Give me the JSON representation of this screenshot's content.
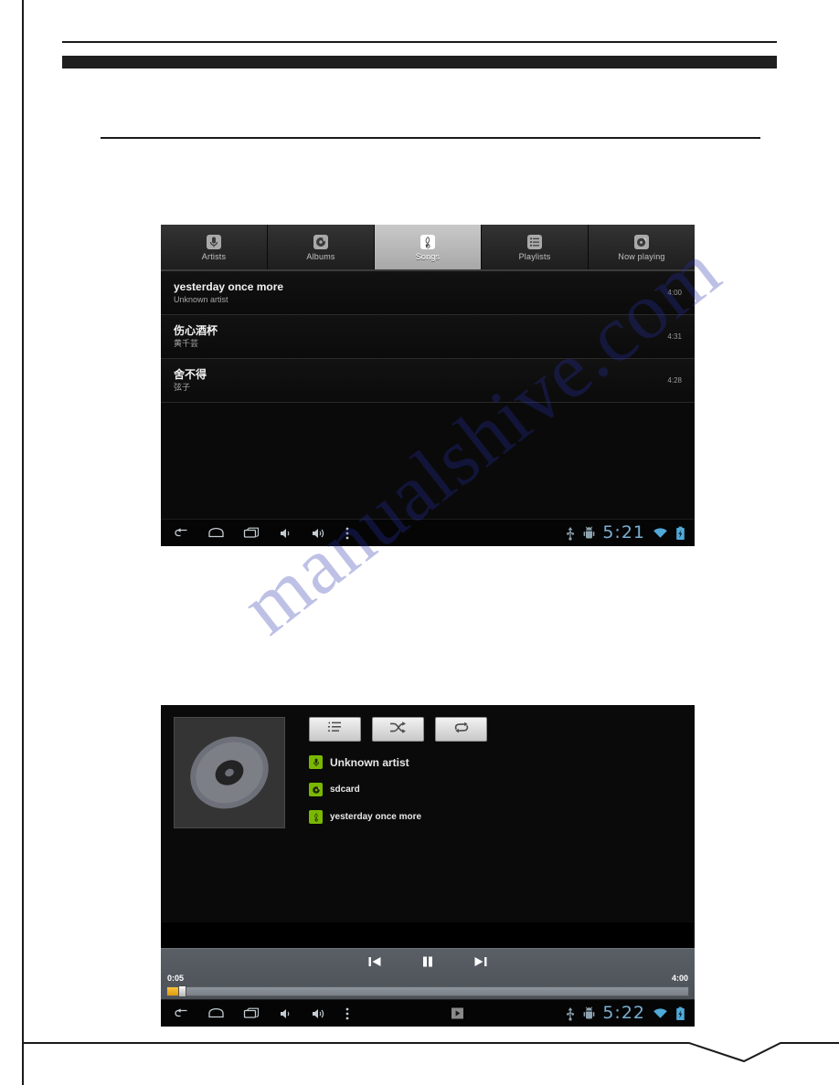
{
  "page": {
    "watermark_text": "manualshive.com"
  },
  "songs_screen": {
    "name": "android-music-songs-list",
    "tabs": [
      {
        "label": "Artists",
        "icon": "microphone-icon",
        "selected": false
      },
      {
        "label": "Albums",
        "icon": "disc-icon",
        "selected": false
      },
      {
        "label": "Songs",
        "icon": "treble-clef-icon",
        "selected": true
      },
      {
        "label": "Playlists",
        "icon": "list-icon",
        "selected": false
      },
      {
        "label": "Now playing",
        "icon": "now-playing-icon",
        "selected": false
      }
    ],
    "songs": [
      {
        "title": "yesterday once more",
        "artist": "Unknown artist",
        "duration": "4:00"
      },
      {
        "title": "伤心酒杯",
        "artist": "黄千芸",
        "duration": "4:31"
      },
      {
        "title": "舍不得",
        "artist": "弦子",
        "duration": "4:28"
      }
    ],
    "navbar": {
      "icons": [
        "back-icon",
        "home-icon",
        "recents-icon",
        "volume-down-icon",
        "volume-up-icon",
        "overflow-menu-icon"
      ],
      "status_icons": [
        "usb-icon",
        "android-debug-icon"
      ],
      "clock": "5:21",
      "tray_icons": [
        "wifi-icon",
        "battery-charging-icon"
      ]
    }
  },
  "player_screen": {
    "name": "android-music-now-playing",
    "album_art": "default-disc-art",
    "control_buttons": [
      {
        "name": "queue-button",
        "icon": "playlist-queue-icon"
      },
      {
        "name": "shuffle-button",
        "icon": "shuffle-icon"
      },
      {
        "name": "repeat-button",
        "icon": "repeat-icon"
      }
    ],
    "meta": [
      {
        "icon": "microphone-icon",
        "label": "Unknown artist"
      },
      {
        "icon": "disc-icon",
        "label": "sdcard"
      },
      {
        "icon": "treble-clef-icon",
        "label": "yesterday once more"
      }
    ],
    "transport": {
      "prev": "previous-track-icon",
      "play_pause": "pause-icon",
      "next": "next-track-icon"
    },
    "seek": {
      "elapsed": "0:05",
      "total": "4:00",
      "progress_percent": 2
    },
    "navbar": {
      "icons": [
        "back-icon",
        "home-icon",
        "recents-icon",
        "volume-down-icon",
        "volume-up-icon",
        "overflow-menu-icon"
      ],
      "media_icon": "media-playing-icon",
      "status_icons": [
        "usb-icon",
        "android-debug-icon"
      ],
      "clock": "5:22",
      "tray_icons": [
        "wifi-icon",
        "battery-charging-icon"
      ]
    }
  },
  "colors": {
    "accent_green": "#7ab800",
    "clock_blue": "#79aed0",
    "progress_orange": "#e09a10"
  }
}
